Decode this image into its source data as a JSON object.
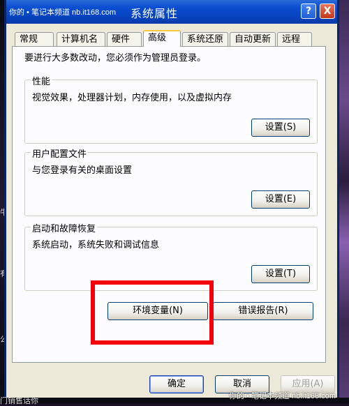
{
  "window": {
    "title": "系统属性",
    "watermark_top": "你的 • 笔记本频道  nb.it168.com",
    "help_label": "?",
    "close_label": "X"
  },
  "tabs": [
    {
      "label": "常规"
    },
    {
      "label": "计算机名"
    },
    {
      "label": "硬件"
    },
    {
      "label": "高级",
      "active": true
    },
    {
      "label": "系统还原"
    },
    {
      "label": "自动更新"
    },
    {
      "label": "远程"
    }
  ],
  "notice": "要进行大多数改动，您必须作为管理员登录。",
  "groups": {
    "performance": {
      "title": "性能",
      "desc": "视觉效果，处理器计划，内存使用，以及虚拟内存",
      "button": "设置(S)"
    },
    "profiles": {
      "title": "用户配置文件",
      "desc": "与您登录有关的桌面设置",
      "button": "设置(E)"
    },
    "startup": {
      "title": "启动和故障恢复",
      "desc": "系统启动，系统失败和调试信息",
      "button": "设置(T)"
    }
  },
  "buttons": {
    "env_vars": "环境变量(N)",
    "error_report": "错误报告(R)",
    "ok": "确定",
    "cancel": "取消",
    "apply": "应用(A)"
  },
  "watermark_bottom": "你的 • 笔记本频道  nb.it168.com",
  "left_edge_texts": [
    "牛",
    "有",
    "公"
  ],
  "bottom_left_text": "门销售话你"
}
